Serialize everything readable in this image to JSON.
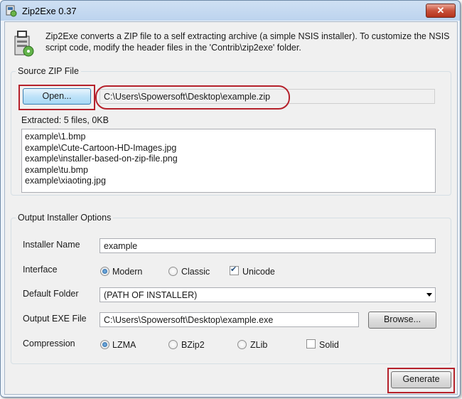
{
  "window": {
    "title": "Zip2Exe 0.37",
    "close_label": "✕"
  },
  "header": {
    "text": "Zip2Exe converts a ZIP file to a self extracting archive (a simple NSIS installer). To customize the NSIS script code, modify the header files in the 'Contrib\\zip2exe' folder."
  },
  "source": {
    "legend": "Source ZIP File",
    "open_label": "Open...",
    "path": "C:\\Users\\Spowersoft\\Desktop\\example.zip",
    "extracted": "Extracted: 5 files, 0KB",
    "files": [
      "example\\1.bmp",
      "example\\Cute-Cartoon-HD-Images.jpg",
      "example\\installer-based-on-zip-file.png",
      "example\\tu.bmp",
      "example\\xiaoting.jpg"
    ]
  },
  "output": {
    "legend": "Output Installer Options",
    "installer_name_label": "Installer Name",
    "installer_name": "example",
    "interface_label": "Interface",
    "interface_modern": "Modern",
    "interface_classic": "Classic",
    "unicode_label": "Unicode",
    "interface_selected": "Modern",
    "unicode_checked": true,
    "default_folder_label": "Default Folder",
    "default_folder": "(PATH OF INSTALLER)",
    "output_exe_label": "Output EXE File",
    "output_exe": "C:\\Users\\Spowersoft\\Desktop\\example.exe",
    "browse_label": "Browse...",
    "compression_label": "Compression",
    "compression_options": [
      "LZMA",
      "BZip2",
      "ZLib"
    ],
    "compression_selected": "LZMA",
    "solid_label": "Solid",
    "solid_checked": false
  },
  "generate_label": "Generate",
  "colors": {
    "highlight": "#b5212b",
    "title_gradient": "#bcd3ee",
    "client_bg": "#f0f0f0"
  }
}
